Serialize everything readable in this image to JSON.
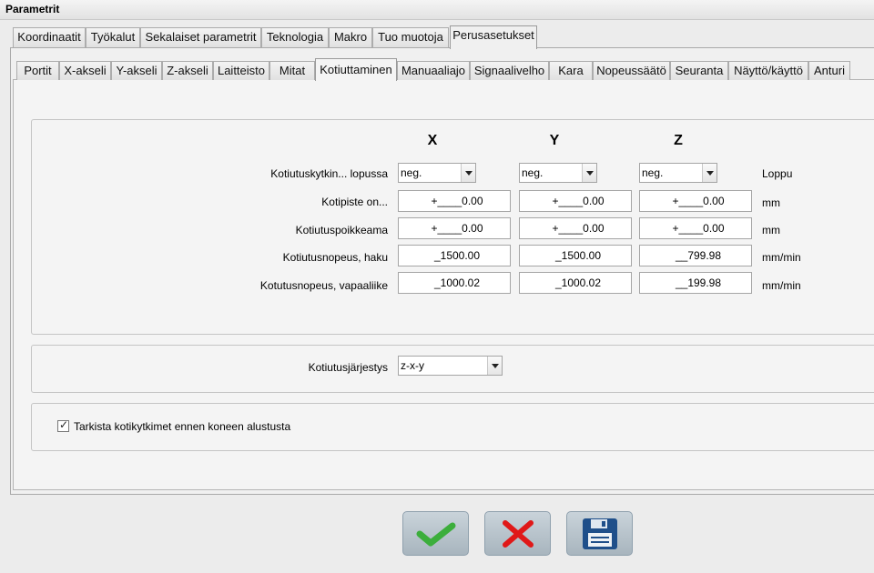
{
  "window": {
    "title": "Parametrit"
  },
  "main_tabs": [
    {
      "label": "Koordinaatit"
    },
    {
      "label": "Työkalut"
    },
    {
      "label": "Sekalaiset parametrit"
    },
    {
      "label": "Teknologia"
    },
    {
      "label": "Makro"
    },
    {
      "label": "Tuo muotoja"
    },
    {
      "label": "Perusasetukset",
      "active": true
    }
  ],
  "sub_tabs": [
    {
      "label": "Portit"
    },
    {
      "label": "X-akseli"
    },
    {
      "label": "Y-akseli"
    },
    {
      "label": "Z-akseli"
    },
    {
      "label": "Laitteisto"
    },
    {
      "label": "Mitat"
    },
    {
      "label": "Kotiuttaminen",
      "active": true
    },
    {
      "label": "Manuaaliajo"
    },
    {
      "label": "Signaalivelho"
    },
    {
      "label": "Kara"
    },
    {
      "label": "Nopeussäätö"
    },
    {
      "label": "Seuranta"
    },
    {
      "label": "Näyttö/käyttö"
    },
    {
      "label": "Anturi"
    }
  ],
  "axes": {
    "x": "X",
    "y": "Y",
    "z": "Z"
  },
  "rows": {
    "switch": {
      "label": "Kotiutuskytkin... lopussa",
      "x": "neg.",
      "y": "neg.",
      "z": "neg.",
      "unit": "Loppu"
    },
    "home_point": {
      "label": "Kotipiste on...",
      "x": "+____0.00",
      "y": "+____0.00",
      "z": "+____0.00",
      "unit": "mm"
    },
    "offset": {
      "label": "Kotiutuspoikkeama",
      "x": "+____0.00",
      "y": "+____0.00",
      "z": "+____0.00",
      "unit": "mm"
    },
    "search_speed": {
      "label": "Kotiutusnopeus, haku",
      "x": "_1500.00",
      "y": "_1500.00",
      "z": "__799.98",
      "unit": "mm/min"
    },
    "release_speed": {
      "label": "Kotutusnopeus, vapaaliike",
      "x": "_1000.02",
      "y": "_1000.02",
      "z": "__199.98",
      "unit": "mm/min"
    }
  },
  "order": {
    "label": "Kotiutusjärjestys",
    "value": "z-x-y"
  },
  "check": {
    "label": "Tarkista kotikytkimet ennen koneen alustusta",
    "checked": true
  },
  "buttons": {
    "ok_icon": "checkmark-icon",
    "cancel_icon": "x-icon",
    "save_icon": "floppy-disk-icon"
  },
  "colors": {
    "ok": "#3cae3c",
    "cancel": "#e01818",
    "save": "#1f4f8a"
  }
}
